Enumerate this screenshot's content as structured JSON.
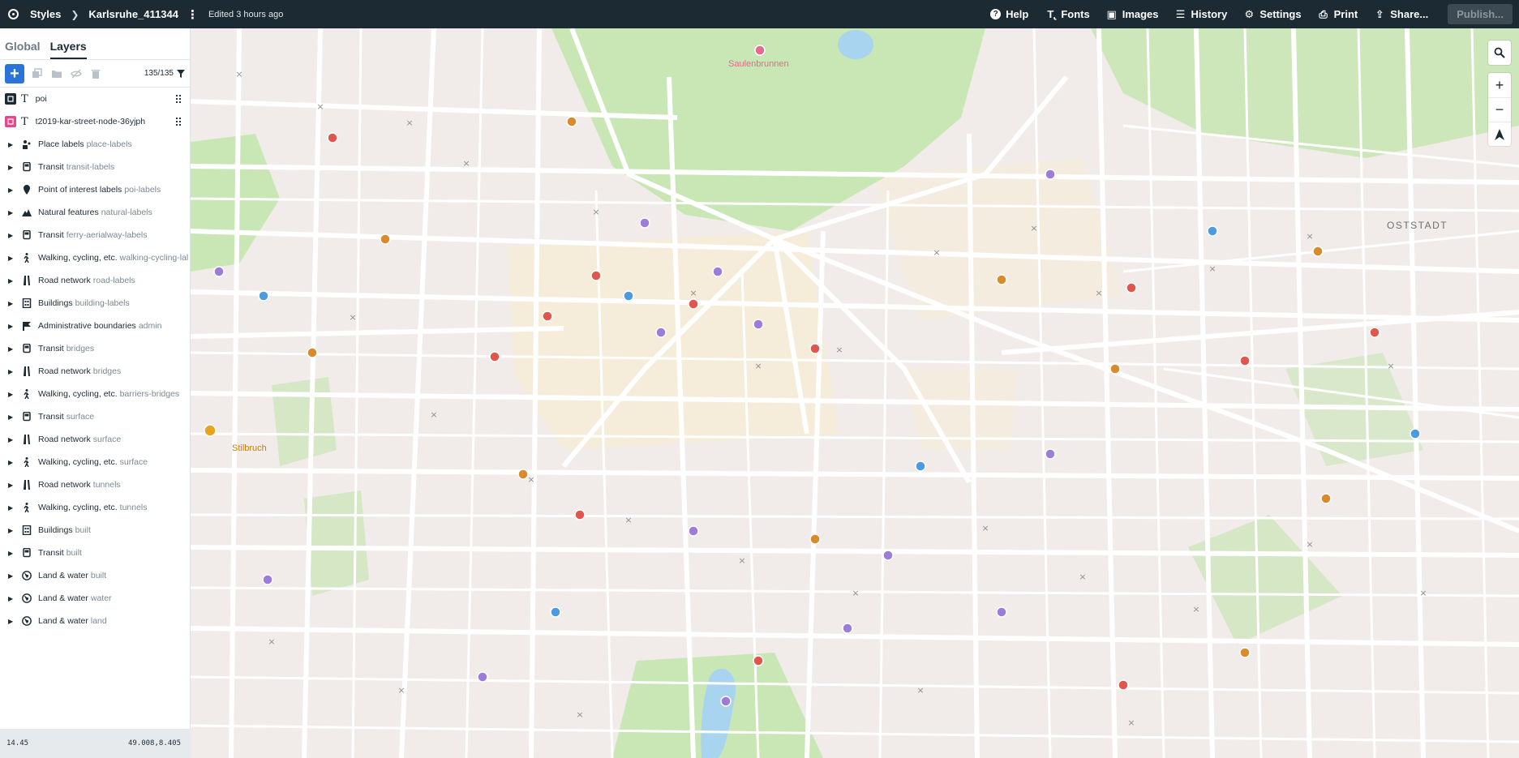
{
  "header": {
    "styles_label": "Styles",
    "style_name": "Karlsruhe_411344",
    "edited": "Edited 3 hours ago",
    "help": "Help",
    "fonts": "Fonts",
    "images": "Images",
    "history": "History",
    "settings": "Settings",
    "print": "Print",
    "share": "Share...",
    "publish": "Publish..."
  },
  "sidebar": {
    "tabs": [
      "Global",
      "Layers"
    ],
    "active_tab": "Layers",
    "layer_count": "135/135",
    "custom_layers": [
      {
        "name": "poi",
        "swatch": "#1b2a33"
      },
      {
        "name": "t2019-kar-street-node-36yjph",
        "swatch": "#e8458b"
      }
    ],
    "groups": [
      {
        "label": "Place labels",
        "sub": "place-labels",
        "icon": "people-icon"
      },
      {
        "label": "Transit",
        "sub": "transit-labels",
        "icon": "bus-icon"
      },
      {
        "label": "Point of interest labels",
        "sub": "poi-labels",
        "icon": "pin-icon"
      },
      {
        "label": "Natural features",
        "sub": "natural-labels",
        "icon": "mountain-icon"
      },
      {
        "label": "Transit",
        "sub": "ferry-aerialway-labels",
        "icon": "bus-icon"
      },
      {
        "label": "Walking, cycling, etc.",
        "sub": "walking-cycling-lal",
        "icon": "walk-icon"
      },
      {
        "label": "Road network",
        "sub": "road-labels",
        "icon": "road-icon"
      },
      {
        "label": "Buildings",
        "sub": "building-labels",
        "icon": "building-icon"
      },
      {
        "label": "Administrative boundaries",
        "sub": "admin",
        "icon": "flag-icon"
      },
      {
        "label": "Transit",
        "sub": "bridges",
        "icon": "bus-icon"
      },
      {
        "label": "Road network",
        "sub": "bridges",
        "icon": "road-icon"
      },
      {
        "label": "Walking, cycling, etc.",
        "sub": "barriers-bridges",
        "icon": "walk-icon"
      },
      {
        "label": "Transit",
        "sub": "surface",
        "icon": "bus-icon"
      },
      {
        "label": "Road network",
        "sub": "surface",
        "icon": "road-icon"
      },
      {
        "label": "Walking, cycling, etc.",
        "sub": "surface",
        "icon": "walk-icon"
      },
      {
        "label": "Road network",
        "sub": "tunnels",
        "icon": "road-icon"
      },
      {
        "label": "Walking, cycling, etc.",
        "sub": "tunnels",
        "icon": "walk-icon"
      },
      {
        "label": "Buildings",
        "sub": "built",
        "icon": "building-icon"
      },
      {
        "label": "Transit",
        "sub": "built",
        "icon": "bus-icon"
      },
      {
        "label": "Land & water",
        "sub": "built",
        "icon": "globe-icon"
      },
      {
        "label": "Land & water",
        "sub": "water",
        "icon": "globe-icon"
      },
      {
        "label": "Land & water",
        "sub": "land",
        "icon": "globe-icon"
      }
    ]
  },
  "status": {
    "zoom": "14.45",
    "coords": "49.008,8.405"
  },
  "map": {
    "labels": {
      "park": "Saulenbrunnen",
      "district": "OSTSTADT",
      "poi": "Stilbruch"
    },
    "colors": {
      "land": "#f1ecea",
      "park": "#c9e6b5",
      "road": "#ffffff",
      "water": "#a8d4f0",
      "commercial": "#f6ecd6"
    }
  }
}
